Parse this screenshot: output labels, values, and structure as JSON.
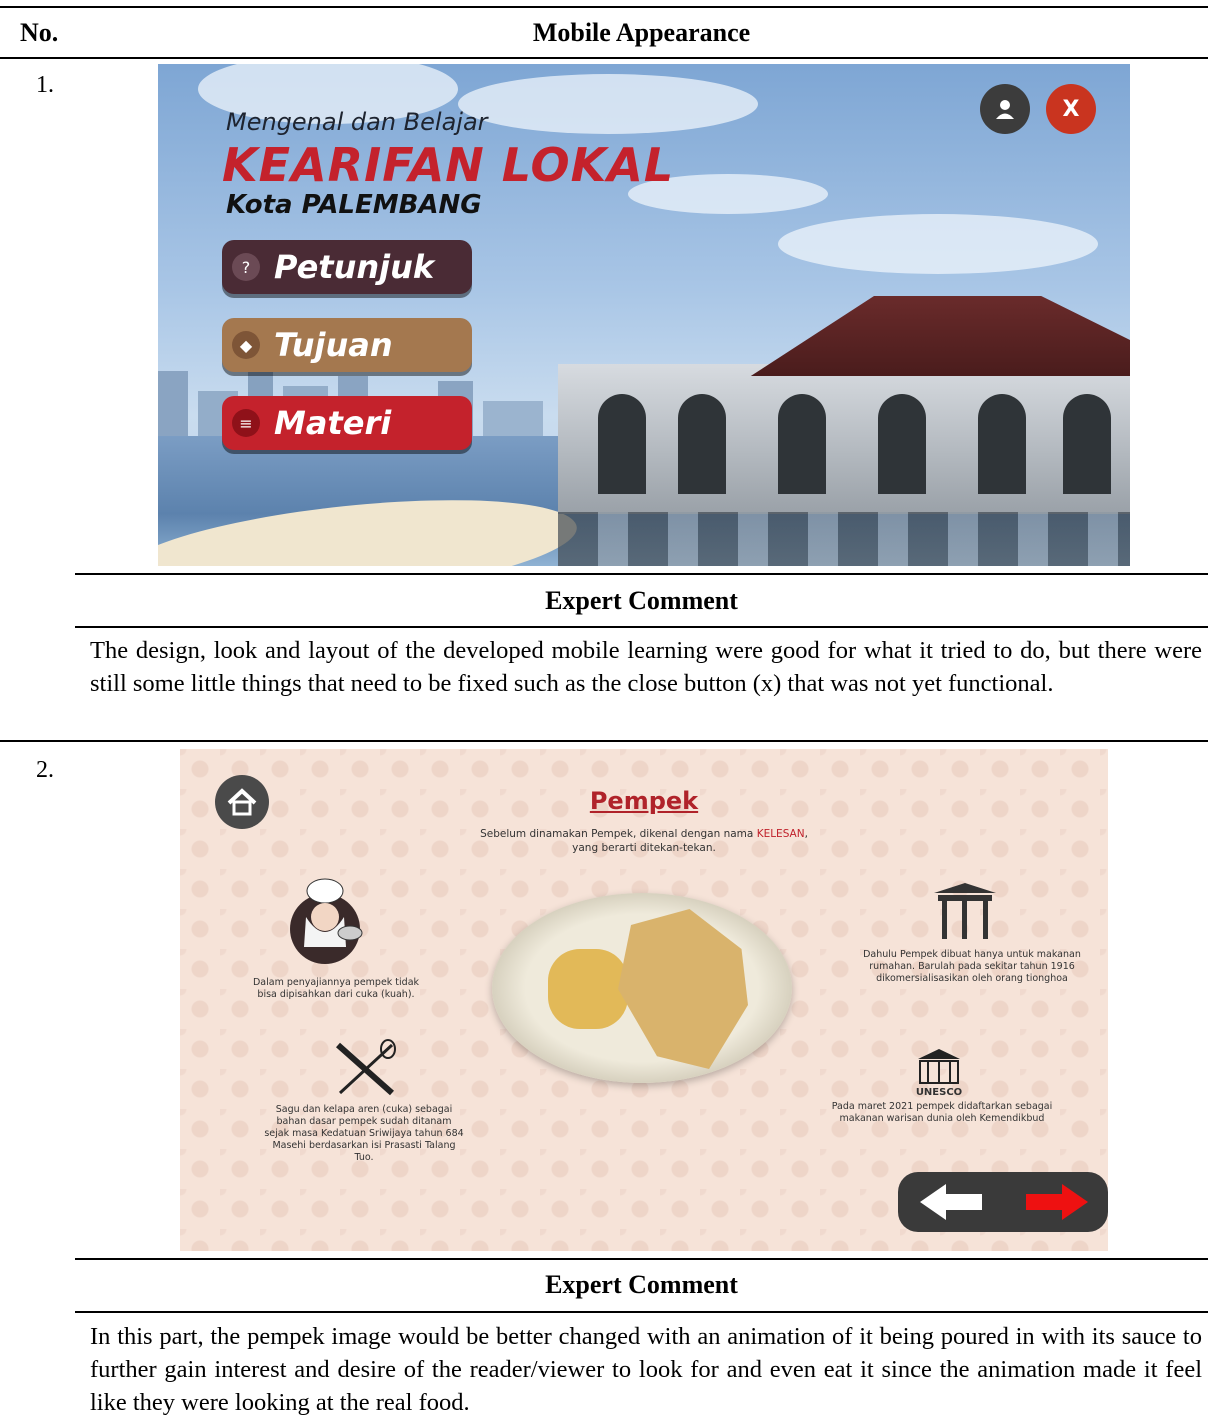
{
  "table": {
    "col_no": "No.",
    "col_appearance": "Mobile Appearance"
  },
  "rows": [
    {
      "number": "1.",
      "screen": {
        "title_small": "Mengenal dan Belajar",
        "title_big": "KEARIFAN LOKAL",
        "title_city": "Kota PALEMBANG",
        "buttons": [
          {
            "label": "Petunjuk",
            "icon": "question-icon",
            "color": "#4a2b35"
          },
          {
            "label": "Tujuan",
            "icon": "diamond-icon",
            "color": "#a4784f"
          },
          {
            "label": "Materi",
            "icon": "menu-lines-icon",
            "color": "#c4222c"
          }
        ],
        "profile_icon": "user-icon",
        "close_label": "X"
      },
      "comment_title": "Expert Comment",
      "comment": "The design, look and layout of the developed mobile learning were good for what it tried to do, but there were still some little things that need to be fixed such as the close button (x) that was not yet functional."
    },
    {
      "number": "2.",
      "screen": {
        "title": "Pempek",
        "subtitle_a": "Sebelum dinamakan Pempek, dikenal dengan nama ",
        "subtitle_highlight": "KELESAN",
        "subtitle_b": ",",
        "subtitle_line2": "yang berarti ditekan-tekan.",
        "note_chef": "Dalam penyajiannya pempek tidak bisa dipisahkan dari cuka (kuah).",
        "note_tools": "Sagu dan kelapa aren (cuka) sebagai bahan dasar pempek sudah ditanam sejak masa Kedatuan Sriwijaya tahun 684 Masehi berdasarkan isi Prasasti Talang Tuo.",
        "note_gate": "Dahulu Pempek dibuat hanya untuk makanan rumahan. Barulah pada sekitar tahun 1916 dikomersialisasikan oleh orang tionghoa",
        "unesco_label": "UNESCO",
        "note_unesco": "Pada maret 2021 pempek didaftarkan sebagai makanan warisan dunia oleh Kemendikbud",
        "home_icon": "home-icon",
        "prev_icon": "arrow-left-icon",
        "next_icon": "arrow-right-icon"
      },
      "comment_title": "Expert Comment",
      "comment": "In this part, the pempek image would be better changed with an animation of it being poured in with its sauce to further gain interest and desire of the reader/viewer to look for and even eat it since the animation made it feel like they were looking at the real food."
    }
  ]
}
